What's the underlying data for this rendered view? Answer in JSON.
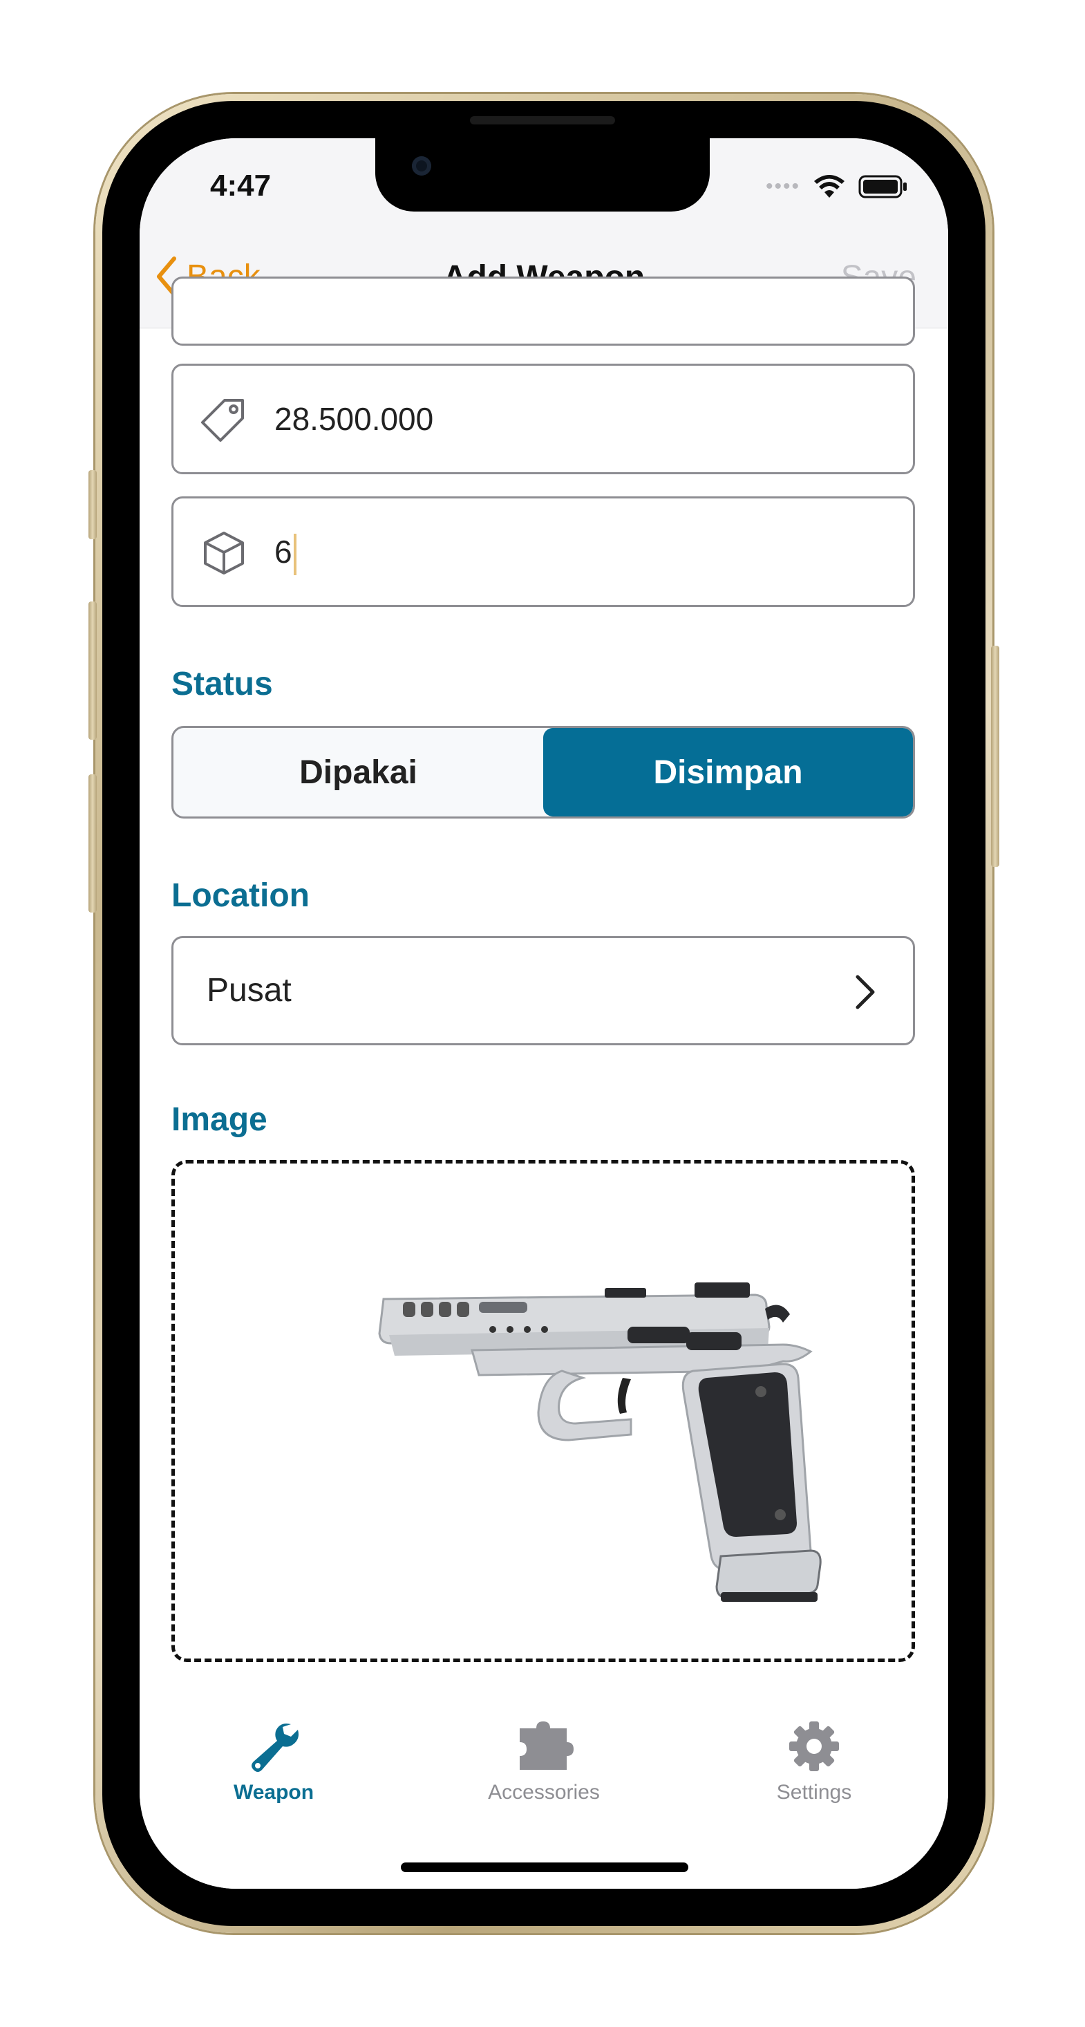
{
  "status_bar": {
    "time": "4:47"
  },
  "nav": {
    "back_label": "Back",
    "title": "Add Weapon",
    "save_label": "Save"
  },
  "form": {
    "price_icon": "tag-icon",
    "price_value": "28.500.000",
    "quantity_icon": "box-icon",
    "quantity_value": "6",
    "status_label": "Status",
    "status_options": [
      "Dipakai",
      "Disimpan"
    ],
    "status_selected": "Disimpan",
    "location_label": "Location",
    "location_value": "Pusat",
    "image_label": "Image",
    "image_content": "pistol-photo"
  },
  "tabbar": {
    "items": [
      {
        "label": "Weapon",
        "icon": "wrench-icon",
        "active": true
      },
      {
        "label": "Accessories",
        "icon": "puzzle-icon",
        "active": false
      },
      {
        "label": "Settings",
        "icon": "gear-icon",
        "active": false
      }
    ]
  },
  "colors": {
    "accent": "#0b6e92",
    "back": "#e8900f",
    "segment_active": "#056e96"
  }
}
